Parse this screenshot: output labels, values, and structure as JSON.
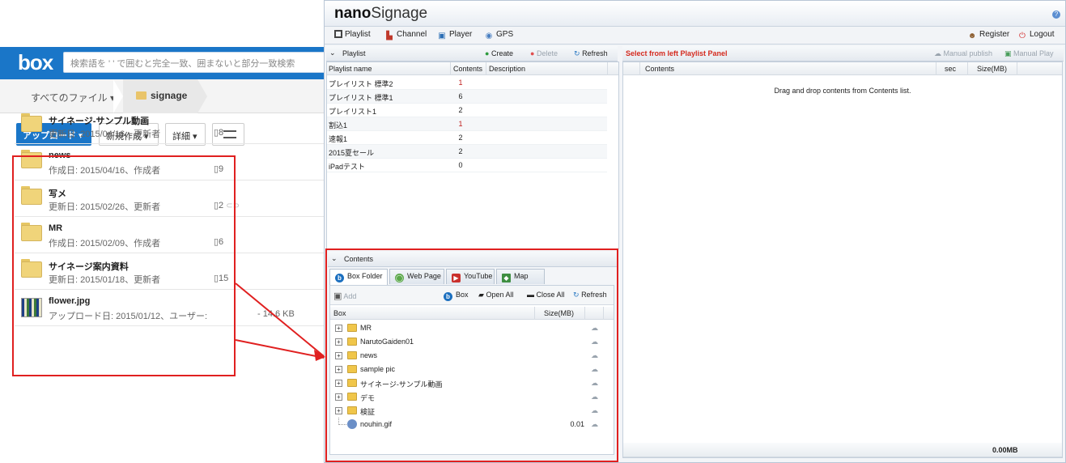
{
  "box": {
    "logo": "box",
    "search_placeholder": "検索語を ' ' で囲むと完全一致、囲まないと部分一致検索",
    "breadcrumb_all": "すべてのファイル ▾",
    "breadcrumb_current": "signage",
    "upload_label": "アップロード ▾",
    "new_label": "新規作成 ▾",
    "detail_label": "詳細 ▾",
    "files": [
      {
        "name": "サイネージ-サンプル動画",
        "meta": "更新日: 2015/04/16、更新者",
        "count": "▯8",
        "size": ""
      },
      {
        "name": "news",
        "meta": "作成日: 2015/04/16、作成者",
        "count": "▯9",
        "size": ""
      },
      {
        "name": "写メ",
        "meta": "更新日: 2015/02/26、更新者",
        "count": "▯2",
        "size": ""
      },
      {
        "name": "MR",
        "meta": "作成日: 2015/02/09、作成者",
        "count": "▯6",
        "size": ""
      },
      {
        "name": "サイネージ案内資料",
        "meta": "更新日: 2015/01/18、更新者",
        "count": "▯15",
        "size": ""
      },
      {
        "name": "flower.jpg",
        "meta": "アップロード日: 2015/01/12、ユーザー:",
        "count": "",
        "size": "- 14.6 KB"
      }
    ]
  },
  "nano": {
    "logo_bold": "nano",
    "logo_rest": "Signage",
    "nav": {
      "playlist": "Playlist",
      "channel": "Channel",
      "player": "Player",
      "gps": "GPS",
      "register": "Register",
      "logout": "Logout"
    },
    "playlist_panel": {
      "title": "Playlist",
      "create": "Create",
      "delete": "Delete",
      "refresh": "Refresh",
      "columns": {
        "name": "Playlist name",
        "contents": "Contents",
        "description": "Description"
      },
      "rows": [
        {
          "name": "プレイリスト 標準2",
          "contents": "1"
        },
        {
          "name": "プレイリスト 標準1",
          "contents": "6"
        },
        {
          "name": "プレイリスト1",
          "contents": "2"
        },
        {
          "name": "割込1",
          "contents": "1"
        },
        {
          "name": "速報1",
          "contents": "2"
        },
        {
          "name": "2015夏セール",
          "contents": "2"
        },
        {
          "name": "iPadテスト",
          "contents": "0"
        }
      ]
    },
    "right_panel": {
      "title": "Select from left Playlist Panel",
      "manual_publish": "Manual publish",
      "manual_play": "Manual Play",
      "columns": {
        "contents": "Contents",
        "sec": "sec",
        "size": "Size(MB)"
      },
      "empty_message": "Drag and drop contents from Contents list.",
      "footer_total": "0.00MB"
    },
    "contents_panel": {
      "title": "Contents",
      "tabs": {
        "box_folder": "Box Folder",
        "web_page": "Web Page",
        "youtube": "YouTube",
        "map": "Map"
      },
      "add": "Add",
      "box": "Box",
      "open_all": "Open All",
      "close_all": "Close All",
      "refresh": "Refresh",
      "columns": {
        "box": "Box",
        "size": "Size(MB)"
      },
      "tree": [
        {
          "label": "MR",
          "size": ""
        },
        {
          "label": "NarutoGaiden01",
          "size": ""
        },
        {
          "label": "news",
          "size": ""
        },
        {
          "label": "sample pic",
          "size": ""
        },
        {
          "label": "サイネージ-サンプル動画",
          "size": ""
        },
        {
          "label": "デモ",
          "size": ""
        },
        {
          "label": "検証",
          "size": ""
        },
        {
          "label": "nouhin.gif",
          "size": "0.01"
        }
      ]
    }
  },
  "colors": {
    "box_blue": "#1a76c8",
    "highlight_red": "#e02020",
    "title_red": "#d42a1e"
  }
}
